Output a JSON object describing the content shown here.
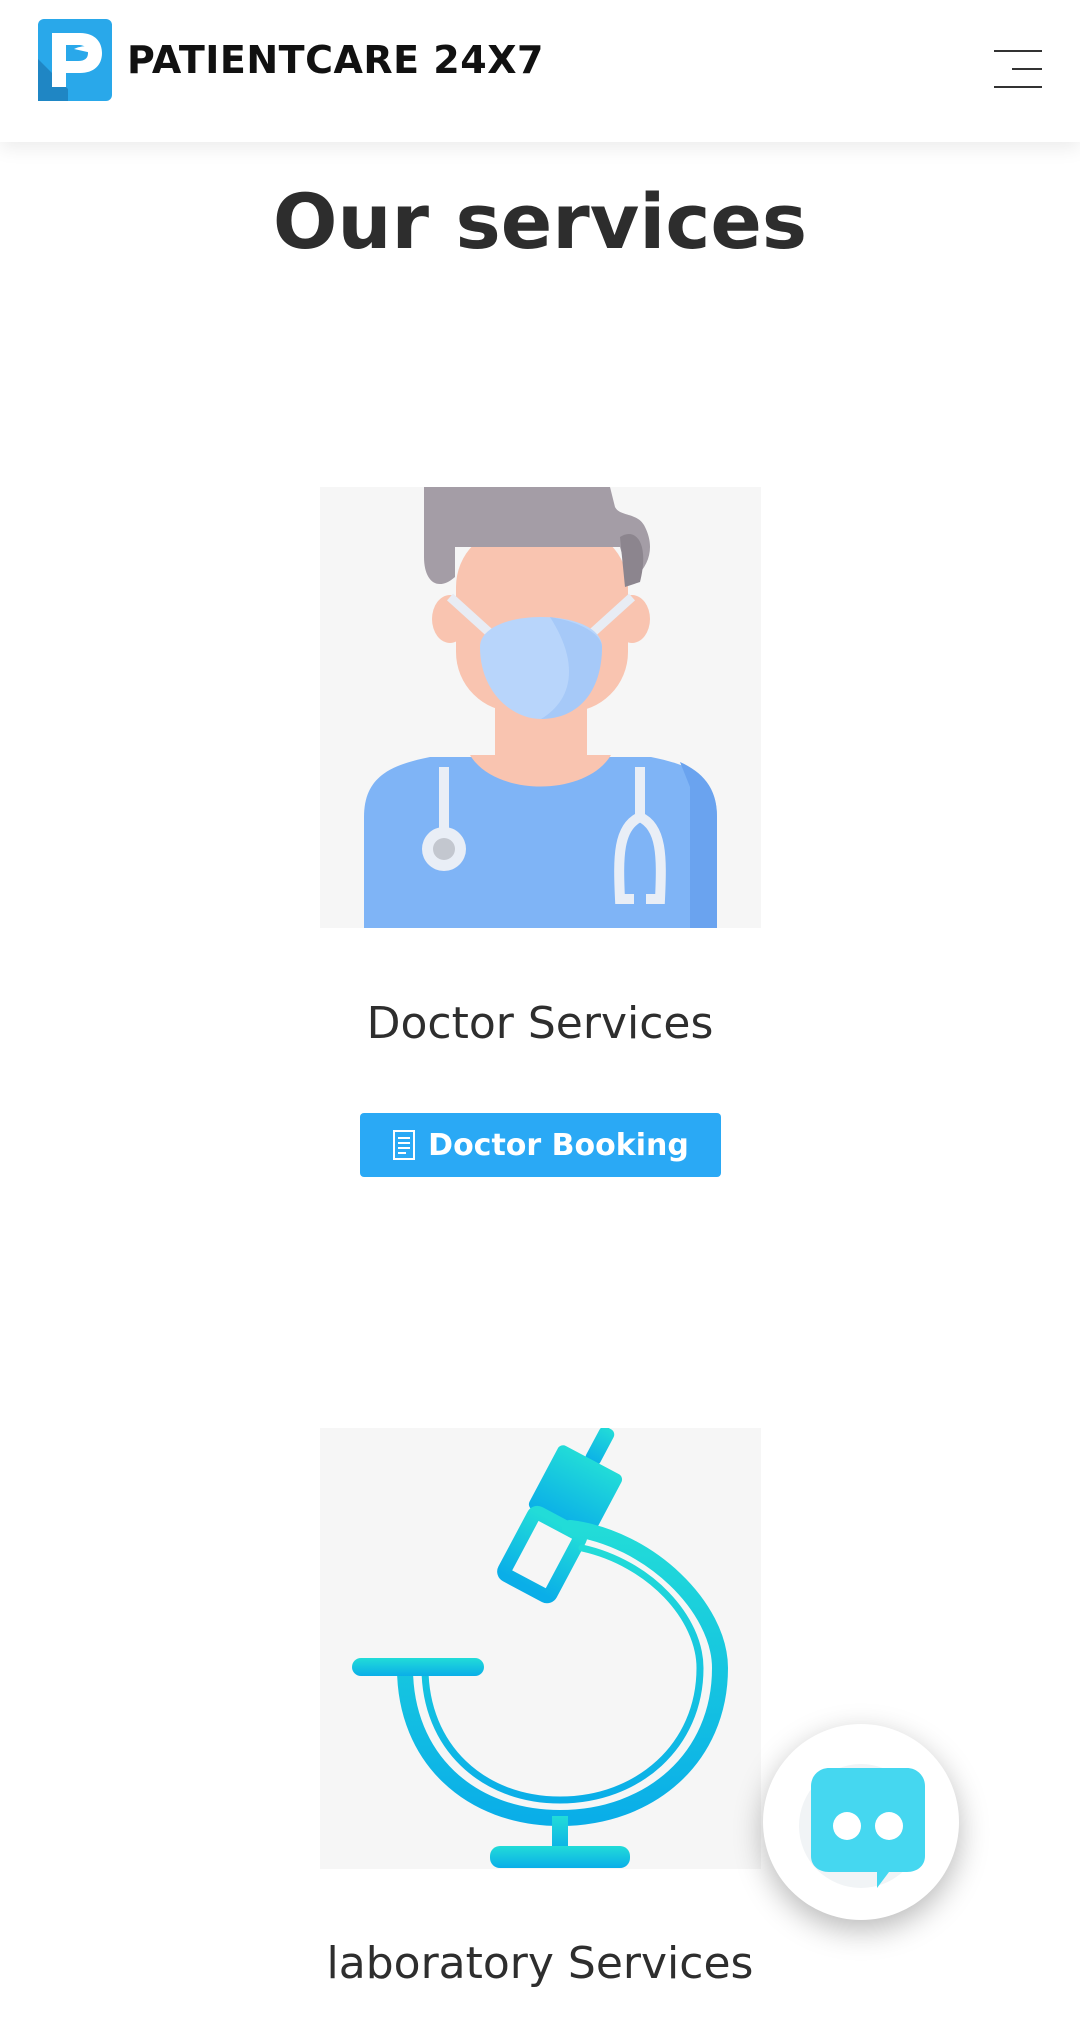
{
  "header": {
    "brand_name": "PATIENTCARE 24X7",
    "logo_icon": "patientcare-logo-icon",
    "menu_icon": "hamburger-menu-icon"
  },
  "main": {
    "title": "Our services",
    "services": [
      {
        "name": "Doctor Services",
        "image_icon": "doctor-illustration",
        "button_label": "Doctor Booking",
        "button_icon": "document-icon"
      },
      {
        "name": "laboratory Services",
        "image_icon": "microscope-illustration"
      }
    ]
  },
  "chat": {
    "icon": "chatbot-icon"
  },
  "colors": {
    "accent": "#2aa9f5",
    "logo_blue": "#29a8ea",
    "doctor_blue": "#7fb4f6",
    "lab_cyan": "#12c8e0"
  }
}
